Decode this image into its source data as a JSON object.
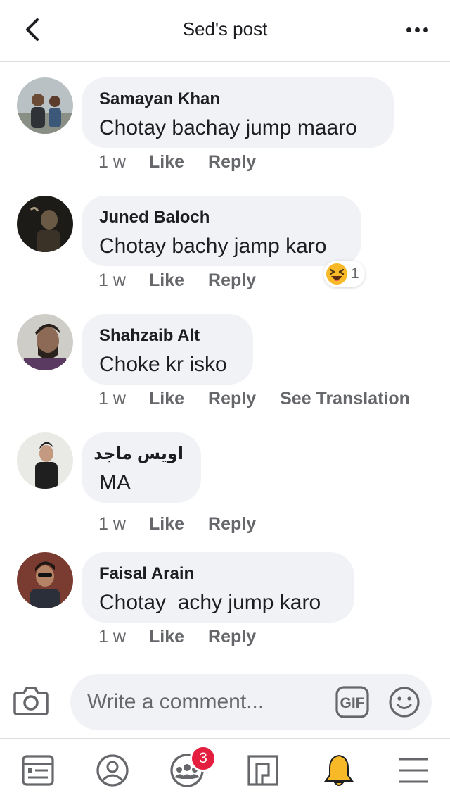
{
  "header": {
    "title": "Sed's post",
    "back_icon": "chevron-left-icon",
    "more_icon": "more-dots-icon"
  },
  "comments": [
    {
      "author": "Samayan Khan",
      "text": "Chotay bachay jump maaro",
      "time": "1 w",
      "like": "Like",
      "reply": "Reply"
    },
    {
      "author": "Juned Baloch",
      "text": "Chotay bachy jamp karo",
      "time": "1 w",
      "like": "Like",
      "reply": "Reply",
      "reaction": {
        "icon": "laughing-emoji-icon",
        "count": "1"
      }
    },
    {
      "author": "Shahzaib Alt",
      "text": "Choke kr isko",
      "time": "1 w",
      "like": "Like",
      "reply": "Reply",
      "see_translation": "See Translation"
    },
    {
      "author": "اویس ماجد",
      "text": "MA",
      "time": "1 w",
      "like": "Like",
      "reply": "Reply"
    },
    {
      "author": "Faisal Arain",
      "text": "Chotay  achy jump karo",
      "time": "1 w",
      "like": "Like",
      "reply": "Reply"
    }
  ],
  "composer": {
    "placeholder": "Write a comment...",
    "camera_icon": "camera-icon",
    "gif_label": "GIF",
    "emoji_icon": "smiley-icon"
  },
  "tabbar": {
    "items": [
      "news-feed-icon",
      "profile-icon",
      "groups-icon",
      "pages-icon",
      "notifications-bell-icon",
      "menu-icon"
    ],
    "groups_badge": "3"
  },
  "colors": {
    "bubble": "#f0f2f5",
    "secondary_text": "#65676b",
    "badge": "#e41e3f",
    "bell": "#f7b928"
  }
}
